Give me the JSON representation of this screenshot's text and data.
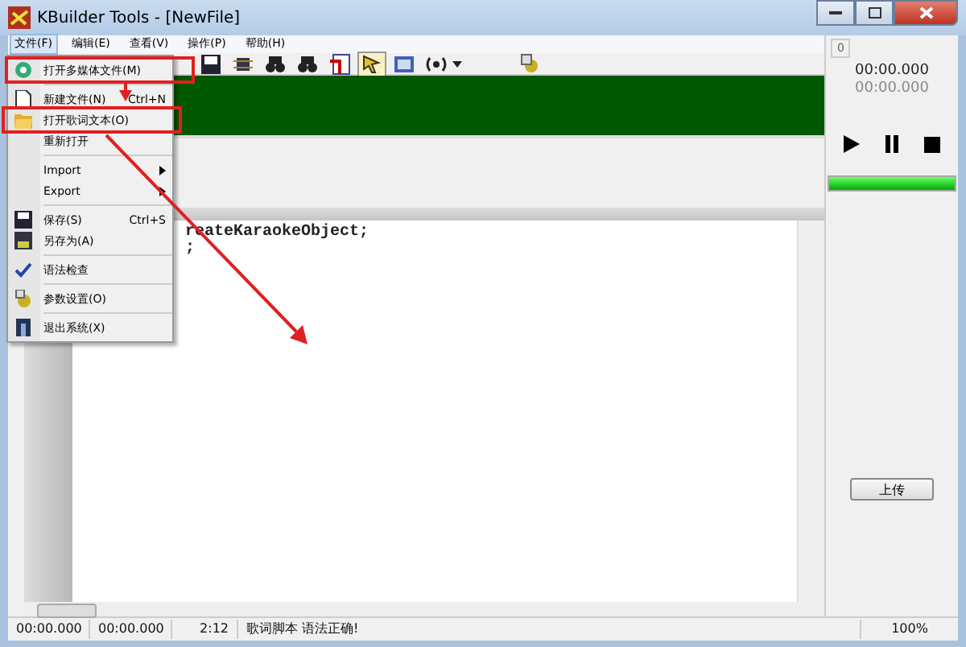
{
  "window": {
    "title": "KBuilder Tools - [NewFile]"
  },
  "menu_bar": [
    {
      "label": "文件(F)",
      "selected": true
    },
    {
      "label": "编辑(E)",
      "selected": false
    },
    {
      "label": "查看(V)",
      "selected": false
    },
    {
      "label": "操作(P)",
      "selected": false
    },
    {
      "label": "帮助(H)",
      "selected": false
    }
  ],
  "file_menu": [
    {
      "kind": "item",
      "label": "打开多媒体文件(M)"
    },
    {
      "kind": "separator"
    },
    {
      "kind": "item",
      "label": "新建文件(N)",
      "shortcut": "Ctrl+N"
    },
    {
      "kind": "item",
      "label": "打开歌词文本(O)"
    },
    {
      "kind": "item",
      "label": "重新打开"
    },
    {
      "kind": "separator"
    },
    {
      "kind": "submenu",
      "label": "Import"
    },
    {
      "kind": "submenu",
      "label": "Export"
    },
    {
      "kind": "separator"
    },
    {
      "kind": "item",
      "label": "保存(S)",
      "shortcut": "Ctrl+S"
    },
    {
      "kind": "item",
      "label": "另存为(A)"
    },
    {
      "kind": "separator"
    },
    {
      "kind": "item",
      "label": "语法检查"
    },
    {
      "kind": "separator"
    },
    {
      "kind": "item",
      "label": "参数设置(O)"
    },
    {
      "kind": "separator"
    },
    {
      "kind": "item",
      "label": "退出系统(X)"
    }
  ],
  "editor": {
    "lines": [
      "reateKaraokeObject;",
      ";"
    ]
  },
  "player": {
    "counter": "0",
    "time": "00:00.000",
    "total": "00:00.000",
    "level": 1,
    "upload_button": "上传"
  },
  "status_bar": [
    "00:00.000",
    "00:00.000",
    "2:12",
    "歌词脚本 语法正确!",
    "100%"
  ]
}
